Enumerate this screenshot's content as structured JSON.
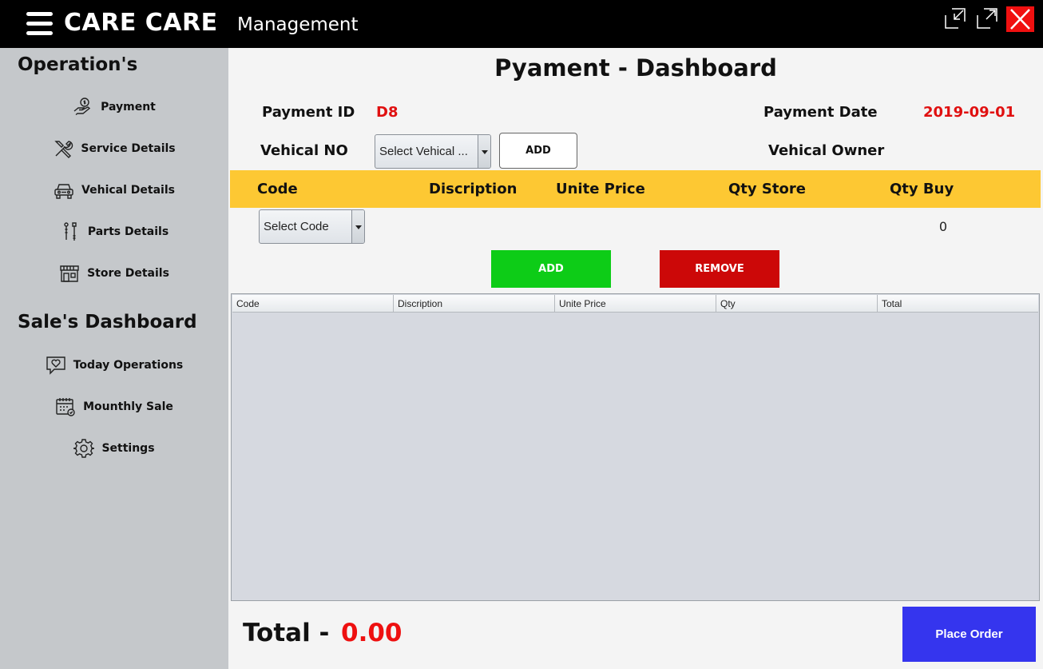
{
  "header": {
    "app_name": "CARE CARE",
    "app_subtitle": "Management",
    "close_color": "#f01010"
  },
  "sidebar": {
    "operations_heading": "Operation's",
    "operations": [
      {
        "label": "Payment",
        "icon": "payment-hand-icon"
      },
      {
        "label": "Service Details",
        "icon": "wrench-icon"
      },
      {
        "label": "Vehical Details",
        "icon": "car-icon"
      },
      {
        "label": "Parts Details",
        "icon": "parts-icon"
      },
      {
        "label": "Store Details",
        "icon": "store-icon"
      }
    ],
    "sales_heading": "Sale's Dashboard",
    "sales": [
      {
        "label": "Today Operations",
        "icon": "chat-heart-icon"
      },
      {
        "label": "Mounthly Sale",
        "icon": "calendar-icon"
      },
      {
        "label": "Settings",
        "icon": "gear-icon"
      }
    ]
  },
  "main": {
    "title": "Pyament - Dashboard",
    "payment_id_label": "Payment ID",
    "payment_id_value": "D8",
    "payment_date_label": "Payment Date",
    "payment_date_value": "2019-09-01",
    "vehical_no_label": "Vehical NO",
    "vehical_select": "Select Vehical ...",
    "vehical_add": "ADD",
    "vehical_owner_label": "Vehical Owner",
    "item_columns": [
      "Code",
      "Discription",
      "Unite Price",
      "Qty Store",
      "Qty Buy"
    ],
    "code_select": "Select Code",
    "qty_buy_value": "0",
    "add_label": "ADD",
    "remove_label": "REMOVE",
    "table_columns": [
      "Code",
      "Discription",
      "Unite Price",
      "Qty",
      "Total"
    ],
    "table_rows": [],
    "total_label": "Total -",
    "total_value": "0.00",
    "place_order": "Place Order",
    "accent_yellow": "#fdc833",
    "add_color": "#0dcc17",
    "remove_color": "#cc0808",
    "place_order_color": "#3535ee"
  }
}
